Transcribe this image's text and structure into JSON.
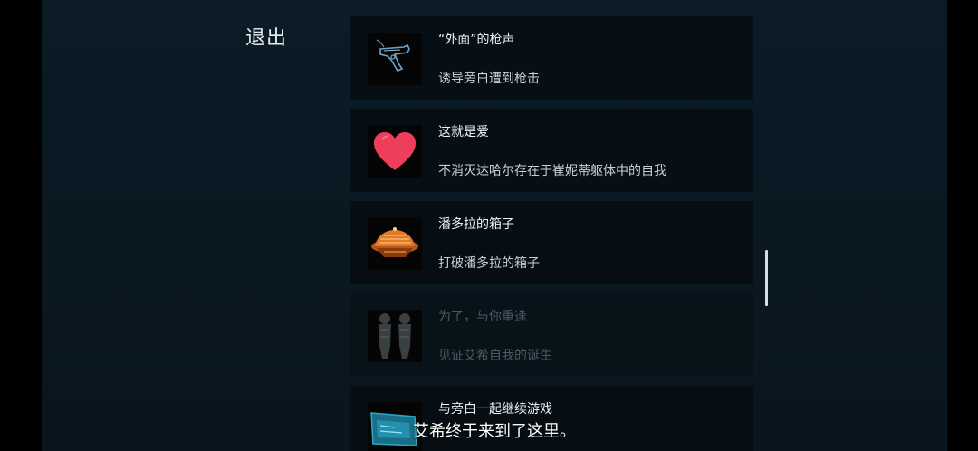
{
  "menu": {
    "exit_label": "退出"
  },
  "achievements": [
    {
      "title": "“外面”的枪声",
      "description": "诱导旁白遭到枪击",
      "icon": "pistol-icon",
      "unlocked": true
    },
    {
      "title": "这就是爱",
      "description": "不消灭达哈尔存在于崔妮蒂躯体中的自我",
      "icon": "heart-icon",
      "unlocked": true
    },
    {
      "title": "潘多拉的箱子",
      "description": "打破潘多拉的箱子",
      "icon": "pandora-box-icon",
      "unlocked": true
    },
    {
      "title": "为了，与你重逢",
      "description": "见证艾希自我的诞生",
      "icon": "twin-figures-icon",
      "unlocked": false
    },
    {
      "title": "与旁白一起继续游戏",
      "description": "",
      "icon": "screen-icon",
      "unlocked": true
    }
  ],
  "subtitle": "艾希终于来到了这里。",
  "colors": {
    "background": "#0a1822",
    "card": "#070e14",
    "heart": "#ef3d5c",
    "pistol": "#6fa3c8",
    "box": "#e07a2a",
    "screen": "#2aa8c8"
  }
}
